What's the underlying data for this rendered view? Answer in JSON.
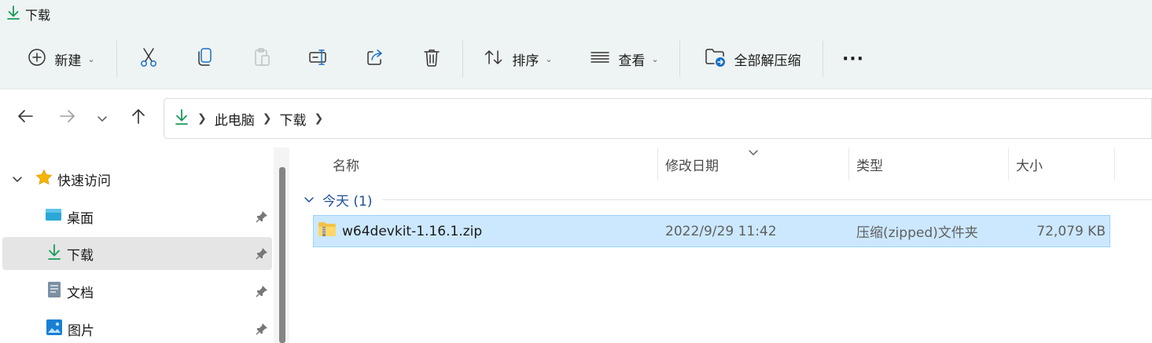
{
  "window": {
    "title": "下载"
  },
  "toolbar": {
    "new_label": "新建",
    "sort_label": "排序",
    "view_label": "查看",
    "extract_all_label": "全部解压缩",
    "more_label": "···"
  },
  "addressbar": {
    "crumbs": [
      "此电脑",
      "下载"
    ]
  },
  "sidebar": {
    "quick_access": "快速访问",
    "items": [
      {
        "label": "桌面"
      },
      {
        "label": "下载"
      },
      {
        "label": "文档"
      },
      {
        "label": "图片"
      }
    ]
  },
  "filelist": {
    "columns": {
      "name": "名称",
      "modified": "修改日期",
      "type": "类型",
      "size": "大小"
    },
    "group_label": "今天 (1)",
    "rows": [
      {
        "name": "w64devkit-1.16.1.zip",
        "modified": "2022/9/29 11:42",
        "type": "压缩(zipped)文件夹",
        "size": "72,079 KB"
      }
    ]
  },
  "colors": {
    "accent": "#0a8a4c",
    "selection": "#cce8ff",
    "selection_border": "#99d1ff",
    "group_text": "#1f4e99"
  }
}
